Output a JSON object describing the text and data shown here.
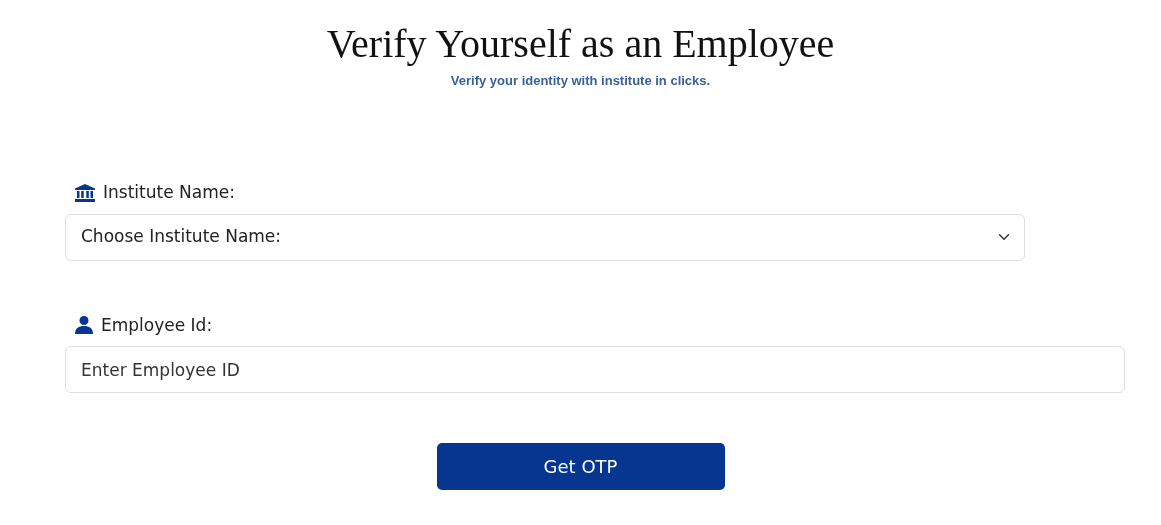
{
  "title": "Verify Yourself as an Employee",
  "subtitle": "Verify your identity with institute in clicks.",
  "fields": [
    {
      "kind": "select",
      "label": "Institute Name:",
      "value": "Choose Institute Name:"
    },
    {
      "kind": "input",
      "label": "Employee Id:",
      "placeholder": "Enter Employee ID"
    }
  ],
  "button": "Get OTP"
}
